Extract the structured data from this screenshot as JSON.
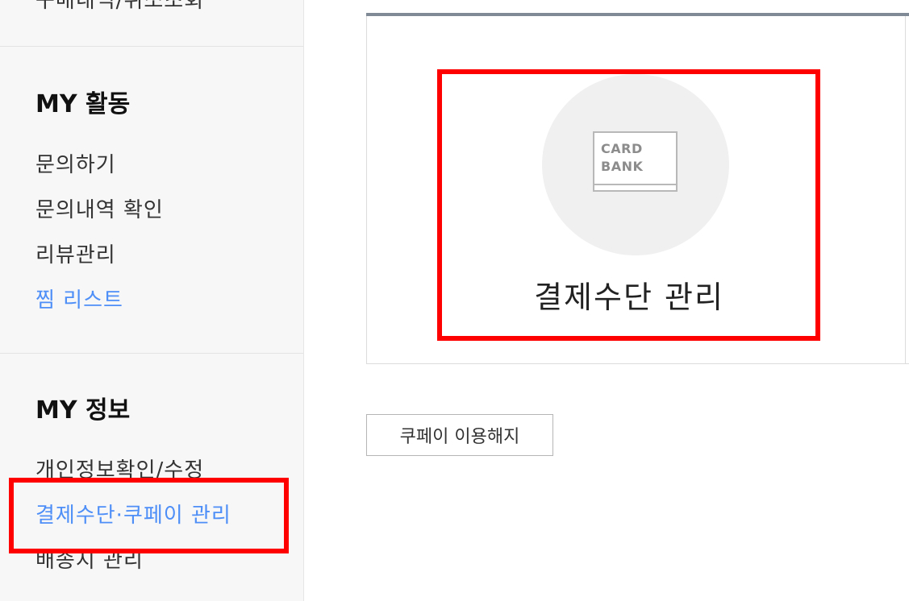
{
  "sidebar": {
    "cut_item": "구매내역/취소조회",
    "sections": [
      {
        "title": "MY 활동",
        "items": [
          {
            "label": "문의하기",
            "active": false
          },
          {
            "label": "문의내역 확인",
            "active": false
          },
          {
            "label": "리뷰관리",
            "active": false
          },
          {
            "label": "찜 리스트",
            "active": true
          }
        ]
      },
      {
        "title": "MY 정보",
        "items": [
          {
            "label": "개인정보확인/수정",
            "active": false
          },
          {
            "label": "결제수단·쿠페이 관리",
            "active": true
          },
          {
            "label": "배송지 관리",
            "active": false
          }
        ]
      }
    ]
  },
  "main": {
    "payment_tile": {
      "icon": "card-bank-icon",
      "icon_text_line1": "CARD",
      "icon_text_line2": "BANK",
      "label": "결제수단 관리"
    },
    "cancel_button_label": "쿠페이 이용해지"
  },
  "colors": {
    "active_link": "#4d8ef7",
    "highlight_box": "#ff0000",
    "sidebar_bg": "#f7f7f7"
  }
}
